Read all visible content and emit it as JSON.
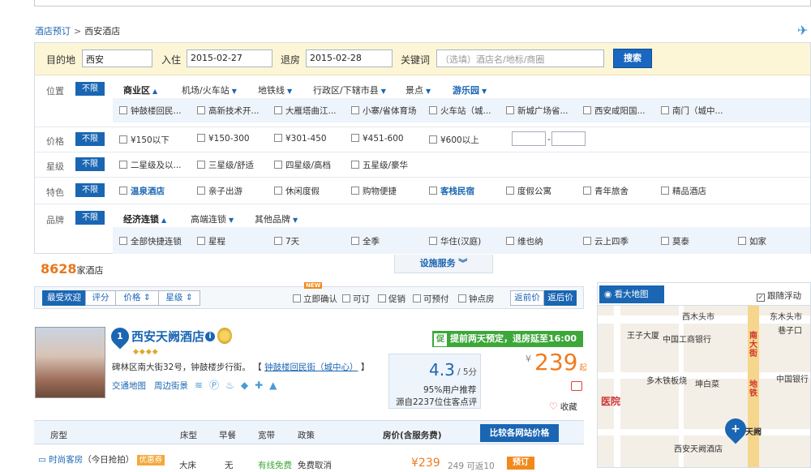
{
  "breadcrumb": {
    "root": "酒店预订",
    "sep": ">",
    "current": "西安酒店"
  },
  "search": {
    "dest_label": "目的地",
    "dest_value": "西安",
    "checkin_label": "入住",
    "checkin_value": "2015-02-27",
    "checkout_label": "退房",
    "checkout_value": "2015-02-28",
    "keyword_label": "关键词",
    "keyword_placeholder": "（选填）酒店名/地标/商圈",
    "button": "搜索"
  },
  "filters": {
    "no_limit": "不限",
    "location": {
      "label": "位置",
      "tabs": [
        "商业区",
        "机场/火车站",
        "地铁线",
        "行政区/下辖市县",
        "景点",
        "游乐园"
      ],
      "options": [
        "钟鼓楼回民...",
        "高新技术开...",
        "大雁塔曲江...",
        "小寨/省体育场",
        "火车站（城...",
        "新城广场省...",
        "西安咸阳国...",
        "南门（城中..."
      ]
    },
    "price": {
      "label": "价格",
      "options": [
        "¥150以下",
        "¥150-300",
        "¥301-450",
        "¥451-600",
        "¥600以上"
      ],
      "dash": "-"
    },
    "star": {
      "label": "星级",
      "options": [
        "二星级及以...",
        "三星级/舒适",
        "四星级/高档",
        "五星级/豪华"
      ]
    },
    "feature": {
      "label": "特色",
      "options": [
        "温泉酒店",
        "亲子出游",
        "休闲度假",
        "购物便捷",
        "客栈民宿",
        "度假公寓",
        "青年旅舍",
        "精品酒店"
      ]
    },
    "brand": {
      "label": "品牌",
      "tabs": [
        "经济连锁",
        "高端连锁",
        "其他品牌"
      ],
      "options": [
        "全部快捷连锁",
        "星程",
        "7天",
        "全季",
        "华住(汉庭)",
        "维也纳",
        "云上四季",
        "莫泰",
        "如家"
      ]
    }
  },
  "summary": {
    "count": "8628",
    "count_suffix": "家酒店",
    "facility": "设施服务"
  },
  "sort": {
    "tabs": [
      "最受欢迎",
      "评分",
      "价格",
      "星级"
    ],
    "new_badge": "NEW",
    "options": [
      "立即确认",
      "可订",
      "促销",
      "可预付",
      "钟点房"
    ],
    "views": [
      "返前价",
      "返后价"
    ]
  },
  "hotel": {
    "index": "1",
    "name": "西安天阙酒店",
    "info": "i",
    "diamonds": "◆◆◆◆",
    "address": "碑林区南大街32号，钟鼓楼步行街。",
    "area_link": "钟鼓楼回民街（城中心）",
    "links": [
      "交通地图",
      "周边街景"
    ],
    "promo_tag": "促",
    "promo_text": "提前两天预定，退房延至16:00",
    "score": "4.3",
    "score_of": "/ 5分",
    "recommend": "95%用户推荐",
    "reviews": "源自2237位住客点评",
    "currency": "¥",
    "price": "239",
    "price_suffix": "起",
    "fav": "收藏"
  },
  "rooms": {
    "headers": [
      "房型",
      "床型",
      "早餐",
      "宽带",
      "政策",
      "房价(含服务费)"
    ],
    "compare": "比较各网站价格",
    "row": {
      "name": "时尚客房",
      "note": "（今日抢拍）",
      "tag": "优惠券",
      "bed": "大床",
      "breakfast": "无",
      "wifi": "有线免费",
      "policy": "免费取消",
      "price": "¥239",
      "return": "249 可返10",
      "book": "预订"
    }
  },
  "map": {
    "button": "看大地图",
    "follow": "跟随浮动",
    "labels": [
      "西木头市",
      "东木头市",
      "巷子口",
      "中国工商银行",
      "王子大厦",
      "多木铁板烧",
      "坤白菜",
      "南大街",
      "地铁",
      "中国银行",
      "医院",
      "西安天阙酒店",
      "天阙"
    ]
  }
}
